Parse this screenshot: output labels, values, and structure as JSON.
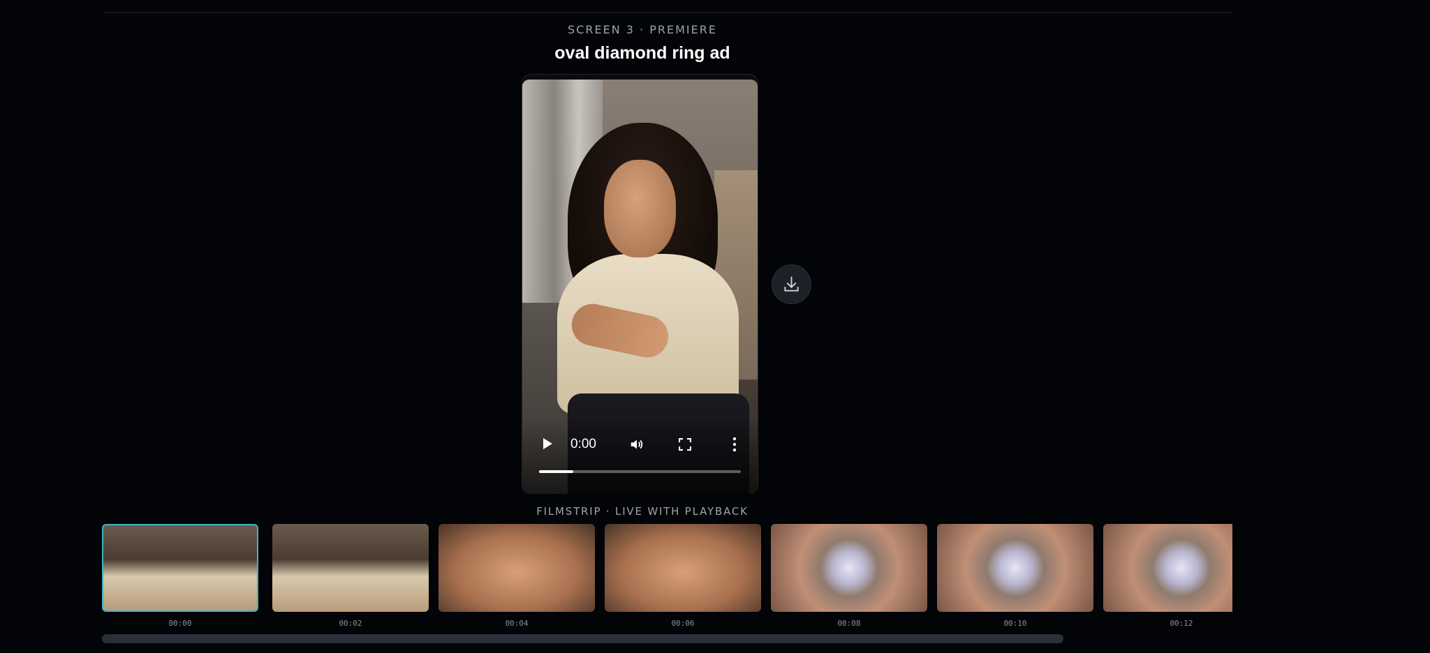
{
  "header": {
    "eyebrow": "SCREEN 3 · PREMIERE",
    "title": "oval diamond ring ad"
  },
  "player": {
    "current_time": "0:00",
    "progress_fraction": 0.17,
    "icons": [
      "play-icon",
      "volume-icon",
      "fullscreen-icon",
      "more-options-icon"
    ]
  },
  "download": {
    "icon": "download-icon"
  },
  "filmstrip": {
    "label": "FILMSTRIP · LIVE WITH PLAYBACK",
    "frames": [
      {
        "timestamp": "00:00",
        "active": true
      },
      {
        "timestamp": "00:02",
        "active": false
      },
      {
        "timestamp": "00:04",
        "active": false
      },
      {
        "timestamp": "00:06",
        "active": false
      },
      {
        "timestamp": "00:08",
        "active": false
      },
      {
        "timestamp": "00:10",
        "active": false
      },
      {
        "timestamp": "00:12",
        "active": false
      }
    ]
  },
  "colors": {
    "background": "#030407",
    "accent": "#3fb3c4",
    "muted_text": "#9ea3ad"
  }
}
